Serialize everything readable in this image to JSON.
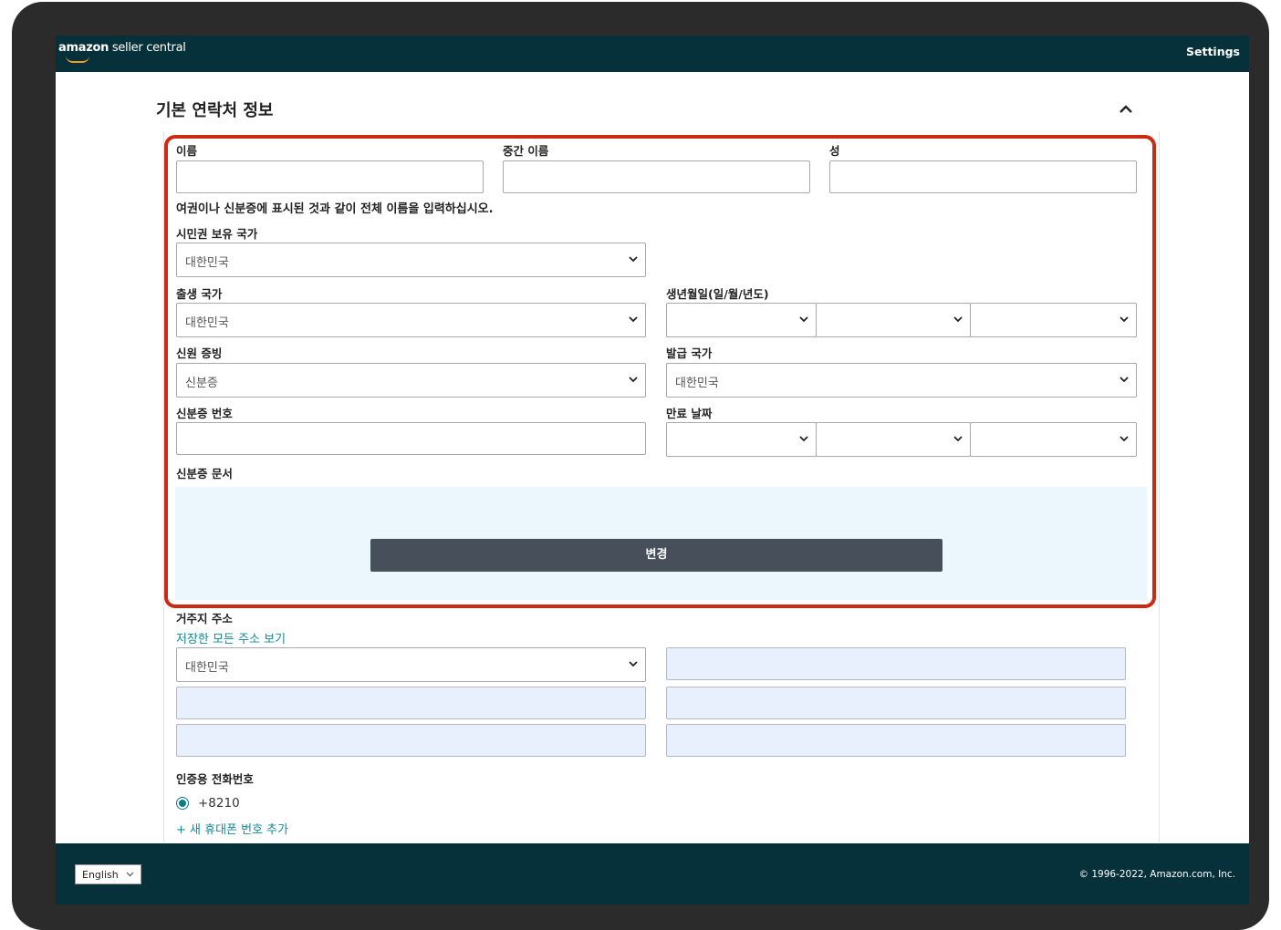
{
  "app": {
    "logo_text": "amazon seller central",
    "logo_bold": "amazon",
    "logo_rest": " seller central",
    "settings_label": "Settings"
  },
  "section": {
    "title": "기본 연락처 정보"
  },
  "name_fields": {
    "first_label": "이름",
    "middle_label": "중간 이름",
    "last_label": "성",
    "note": "여권이나 신분증에 표시된 것과 같이 전체 이름을 입력하십시오."
  },
  "citizenship": {
    "label": "시민권 보유 국가",
    "value": "대한민국"
  },
  "birth_country": {
    "label": "출생 국가",
    "value": "대한민국"
  },
  "dob": {
    "label": "생년월일(일/월/년도)",
    "day": "",
    "month": "",
    "year": ""
  },
  "id_proof": {
    "label": "신원 증빙",
    "value": "신분증"
  },
  "issuing_country": {
    "label": "발급 국가",
    "value": "대한민국"
  },
  "id_number": {
    "label": "신분증 번호",
    "value": ""
  },
  "expiry": {
    "label": "만료 날짜",
    "day": "",
    "month": "",
    "year": ""
  },
  "id_document": {
    "label": "신분증 문서",
    "change_button": "변경"
  },
  "address": {
    "label": "거주지 주소",
    "view_all_link": "저장한 모든 주소 보기",
    "country_value": "대한민국"
  },
  "phone": {
    "label": "인증용 전화번호",
    "number": "+8210",
    "add_link": "+ 새 휴대폰 번호 추가"
  },
  "footer": {
    "language": "English",
    "copyright": "© 1996-2022, Amazon.com, Inc."
  },
  "colors": {
    "header_bg": "#06313a",
    "highlight_border": "#cc2a12",
    "link": "#118a97",
    "button_bg": "#47505a",
    "upload_bg": "#ebf6fd"
  },
  "icons": [
    "chevron-up-icon",
    "chevron-down-icon",
    "radio-selected-icon"
  ]
}
